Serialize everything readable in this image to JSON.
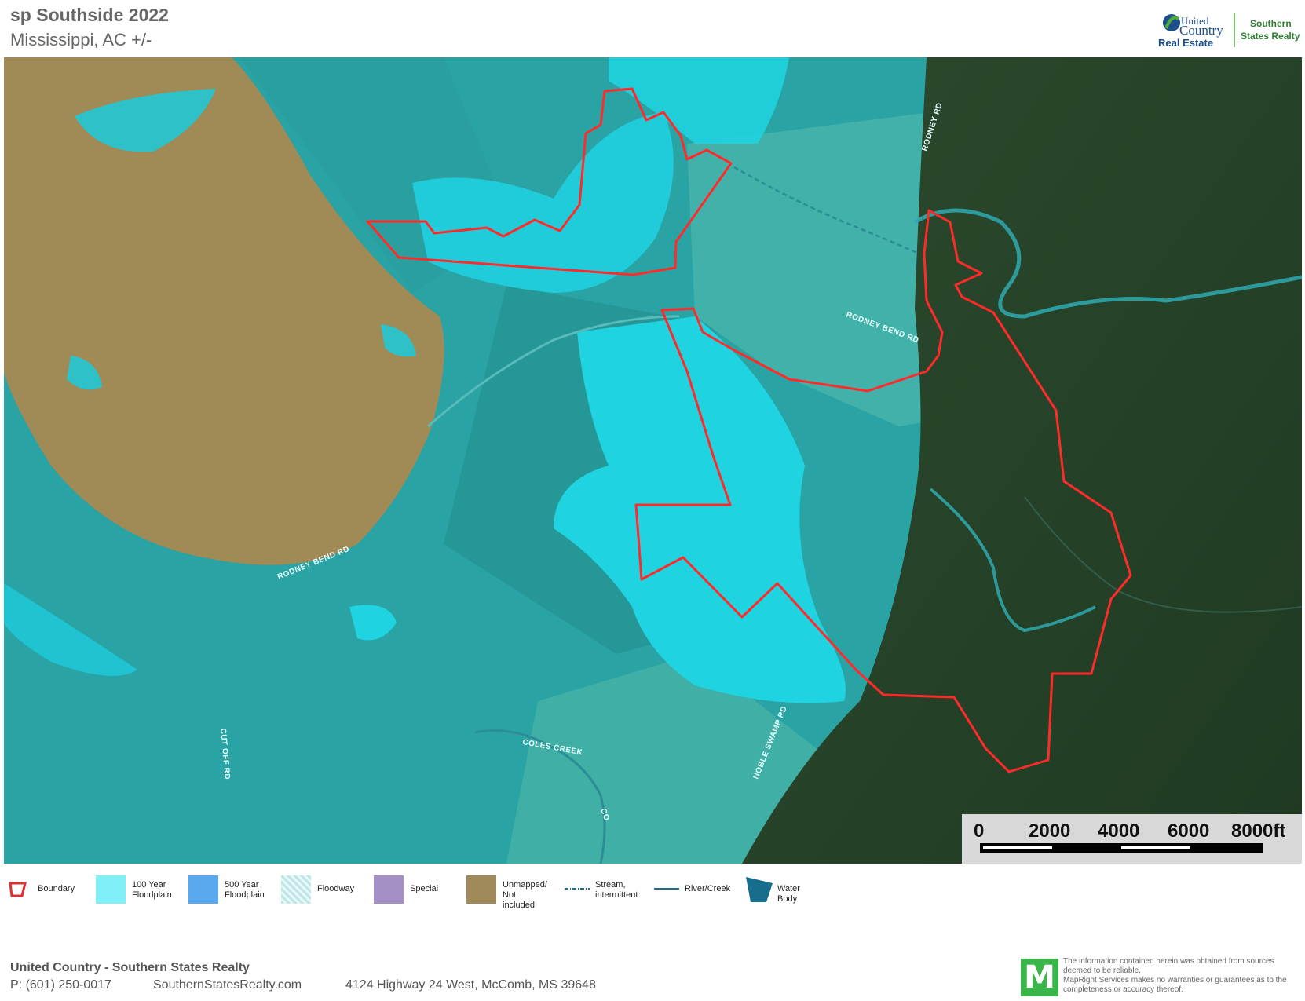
{
  "header": {
    "title": "sp Southside 2022",
    "subtitle": "Mississippi,  AC +/-"
  },
  "logo": {
    "brand_line1": "United",
    "brand_line2": "Country",
    "brand_line3": "Real Estate",
    "partner_line1": "Southern",
    "partner_line2": "States Realty"
  },
  "map": {
    "road_labels": [
      "RODNEY RD",
      "RODNEY BEND RD",
      "RODNEY BEND RD",
      "CUT OFF RD",
      "COLES CREEK",
      "NOBLE SWAMP RD",
      "CO"
    ],
    "boundary_color": "#ff2b2b",
    "floodplain_100yr_color": "#1fd8e6",
    "unmapped_color": "#a08a55",
    "forest_color": "#2a4a2c"
  },
  "scale": {
    "labels": [
      "0",
      "2000",
      "4000",
      "6000",
      "8000ft"
    ]
  },
  "legend": [
    {
      "label": "Boundary",
      "icon": "boundary-icon",
      "color": "#d93030"
    },
    {
      "label": "100 Year\nFloodplain",
      "icon": "floodplain-100-swatch",
      "color": "#7ff0f8"
    },
    {
      "label": "500 Year\nFloodplain",
      "icon": "floodplain-500-swatch",
      "color": "#5aa9ef"
    },
    {
      "label": "Floodway",
      "icon": "floodway-swatch",
      "color": "#bfe6e6"
    },
    {
      "label": "Special",
      "icon": "special-swatch",
      "color": "#a58fc7"
    },
    {
      "label": "Unmapped/\nNot included",
      "icon": "unmapped-swatch",
      "color": "#a08a5a"
    },
    {
      "label": "Stream,\nintermittent",
      "icon": "stream-intermittent-icon",
      "color": "#1c6c8c"
    },
    {
      "label": "River/Creek",
      "icon": "river-creek-icon",
      "color": "#1c6c8c"
    },
    {
      "label": "Water Body",
      "icon": "water-body-icon",
      "color": "#166e8c"
    }
  ],
  "footer": {
    "company": "United Country - Southern States Realty",
    "phone": "P: (601) 250-0017",
    "website": "SouthernStatesRealty.com",
    "address": "4124 Highway 24 West, McComb, MS 39648",
    "mapright_logo": "M",
    "disclaimer": "The information contained herein was obtained from sources deemed to be reliable.\nMapRight Services makes no warranties or guarantees as to the completeness or accuracy thereof."
  }
}
